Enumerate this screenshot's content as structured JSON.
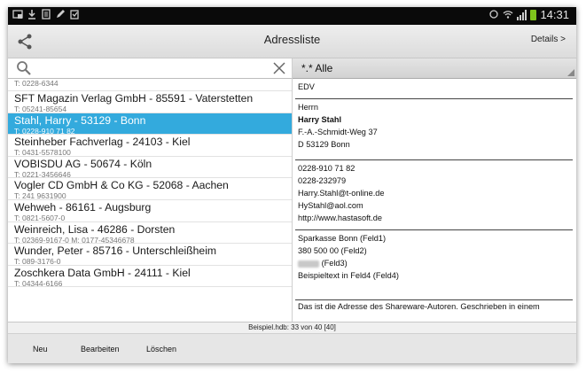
{
  "status_bar": {
    "time": "14:31"
  },
  "action_bar": {
    "title": "Adressliste",
    "details_label": "Details >"
  },
  "filter": {
    "label": "*.* Alle"
  },
  "list": {
    "top_phone": "T: 0228-6344",
    "items": [
      {
        "name": "SFT Magazin Verlag GmbH - 85591 - Vaterstetten",
        "phone": "T: 05241-85654"
      },
      {
        "name": "Stahl, Harry - 53129 - Bonn",
        "phone": "T: 0228-910 71 82",
        "selected": true
      },
      {
        "name": "Steinheber Fachverlag - 24103 - Kiel",
        "phone": "T: 0431-5578100"
      },
      {
        "name": "VOBISDU AG - 50674 - Köln",
        "phone": "T: 0221-3456646"
      },
      {
        "name": "Vogler CD GmbH & Co KG - 52068 - Aachen",
        "phone": "T: 241 9631900"
      },
      {
        "name": "Wehweh - 86161 - Augsburg",
        "phone": "T: 0821-5607-0"
      },
      {
        "name": "Weinreich, Lisa - 46286 - Dorsten",
        "phone": "T: 02369-9167-0 M: 0177-45346678"
      },
      {
        "name": "Wunder, Peter - 85716 - Unterschleißheim",
        "phone": "T: 089-3176-0"
      },
      {
        "name": "Zoschkera Data GmbH - 24111 - Kiel",
        "phone": "T: 04344-6166"
      }
    ]
  },
  "detail": {
    "category": "EDV",
    "salutation": "Herrn",
    "name": "Harry Stahl",
    "street": "F.-A.-Schmidt-Weg 37",
    "city": "D 53129 Bonn",
    "phone1": "0228-910 71 82",
    "phone2": "0228-232979",
    "email1": "Harry.Stahl@t-online.de",
    "email2": "HyStahl@aol.com",
    "web": "http://www.hastasoft.de",
    "bank": "Sparkasse Bonn (Feld1)",
    "blz": "380 500 00 (Feld2)",
    "feld3_label": "(Feld3)",
    "feld4": "Beispieltext in Feld4 (Feld4)",
    "note": "Das ist die Adresse des Shareware-Autoren. Geschrieben in einem"
  },
  "status_line": "Beispiel.hdb: 33 von 40 [40]",
  "bottom_bar": {
    "new_label": "Neu",
    "edit_label": "Bearbeiten",
    "delete_label": "Löschen"
  }
}
